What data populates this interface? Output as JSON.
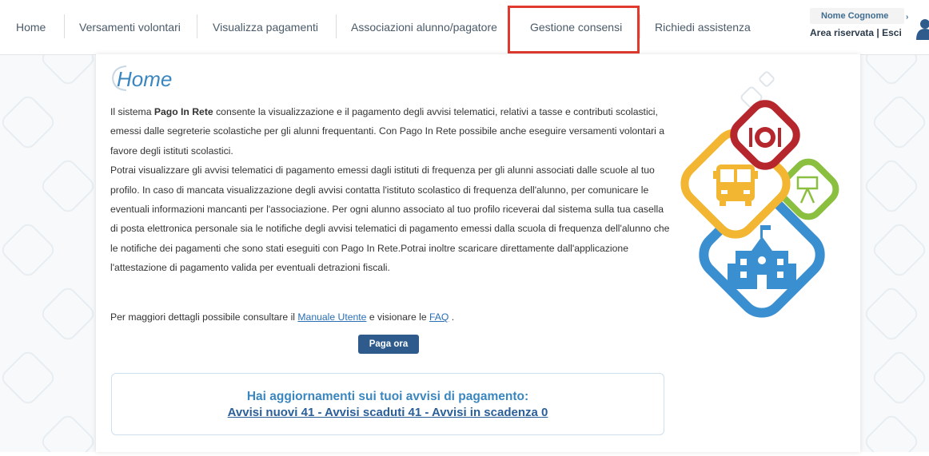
{
  "nav": {
    "items": [
      {
        "label": "Home"
      },
      {
        "label": "Versamenti volontari"
      },
      {
        "label": "Visualizza pagamenti"
      },
      {
        "label": "Associazioni alunno/pagatore"
      },
      {
        "label": "Gestione consensi"
      },
      {
        "label": "Richiedi assistenza"
      }
    ],
    "highlighted": "Gestione consensi",
    "highlight_color": "#e03a2e"
  },
  "user": {
    "name": "Nome Cognome",
    "area_link": "Area riservata",
    "separator": "|",
    "logout": "Esci"
  },
  "page": {
    "title": "Home",
    "intro": {
      "p1_prefix": "Il sistema ",
      "p1_bold": "Pago In Rete",
      "p1_rest": " consente la visualizzazione e il pagamento degli avvisi telematici, relativi a tasse e contributi scolastici, emessi dalle segreterie scolastiche per gli alunni frequentanti. Con Pago In Rete possibile anche eseguire versamenti volontari a favore degli istituti scolastici.",
      "p2": "Potrai visualizzare gli avvisi telematici di pagamento emessi dagli istituti di frequenza per gli alunni associati dalle scuole al tuo profilo. In caso di mancata visualizzazione degli avvisi contatta l'istituto scolastico di frequenza dell'alunno, per comunicare le eventuali informazioni mancanti per l'associazione. Per ogni alunno associato al tuo profilo riceverai dal sistema sulla tua casella di posta elettronica personale sia le notifiche degli avvisi telematici di pagamento emessi dalla scuola di frequenza dell'alunno che le notifiche dei pagamenti che sono stati eseguiti con Pago In Rete.Potrai inoltre scaricare direttamente dall'applicazione l'attestazione di pagamento valida per eventuali detrazioni fiscali."
    },
    "details": {
      "prefix": "Per maggiori dettagli possibile consultare il ",
      "manual_link": "Manuale Utente",
      "middle": " e visionare le ",
      "faq_link": "FAQ",
      "suffix": " ."
    },
    "pay_button": "Paga ora",
    "notice": {
      "title": "Hai aggiornamenti sui tuoi avvisi di pagamento:",
      "summary": "Avvisi nuovi 41 - Avvisi scaduti 41 - Avvisi in scadenza 0"
    }
  },
  "colors": {
    "accent": "#3a86bf",
    "button": "#2f5b8c",
    "icon_red": "#b5272d",
    "icon_yellow": "#f2b632",
    "icon_green": "#8bbf3f",
    "icon_blue": "#3a8fd0"
  }
}
